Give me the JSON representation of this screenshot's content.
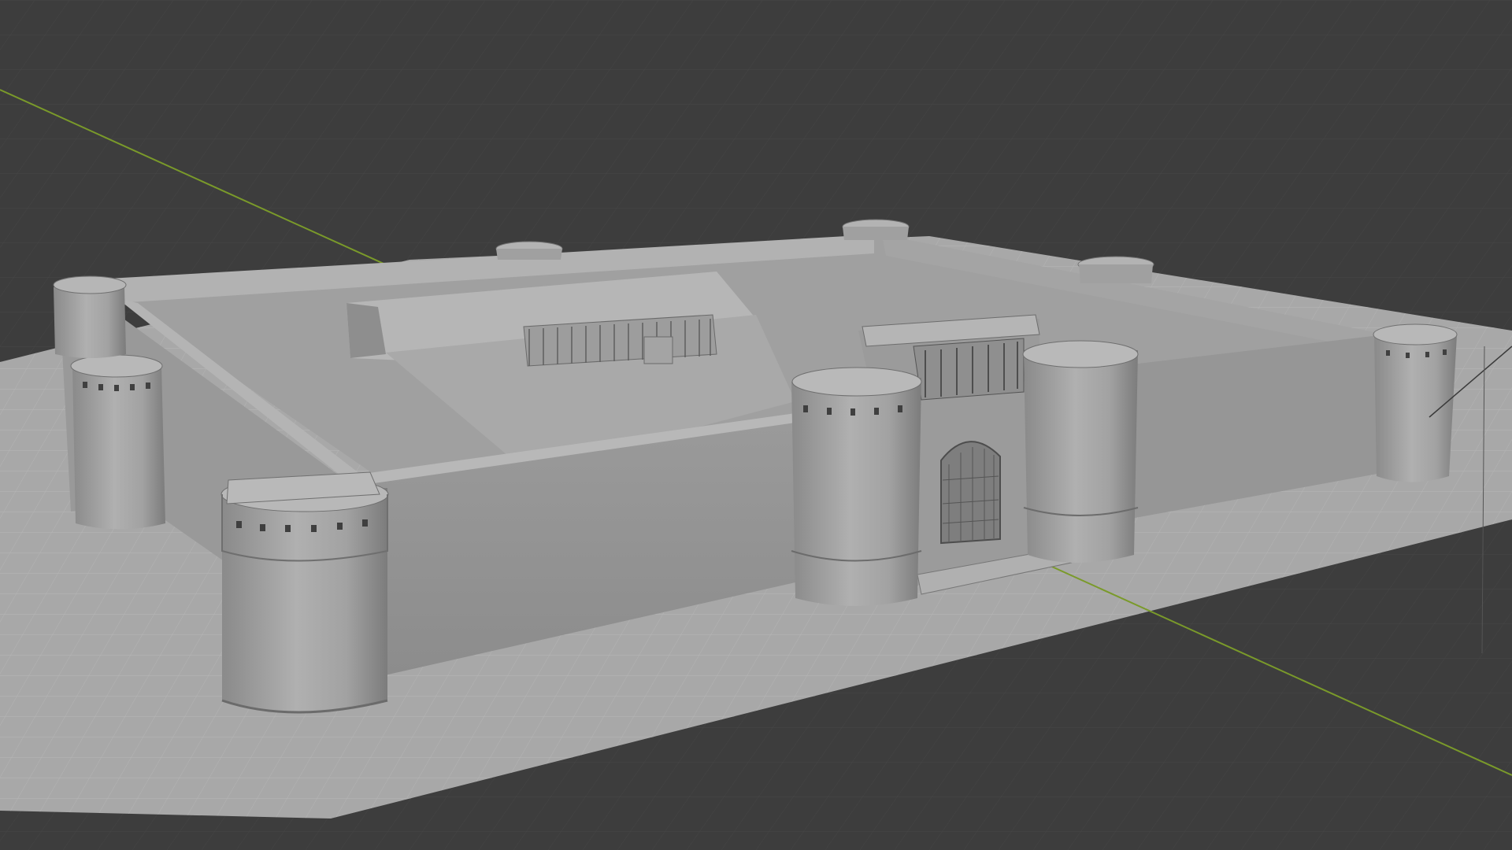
{
  "app": "3D Viewport",
  "viewport": {
    "shading_mode": "solid",
    "background_color": "#3d3d3d",
    "grid_line_color": "#4a4a4a",
    "x_axis_color": "#7a9a2a",
    "model_color": "#9c9c9c",
    "ground_plane_color": "#a6a6a6"
  },
  "scene": {
    "object": "fort-model",
    "towers": 8,
    "gate": "arched-gateway"
  }
}
